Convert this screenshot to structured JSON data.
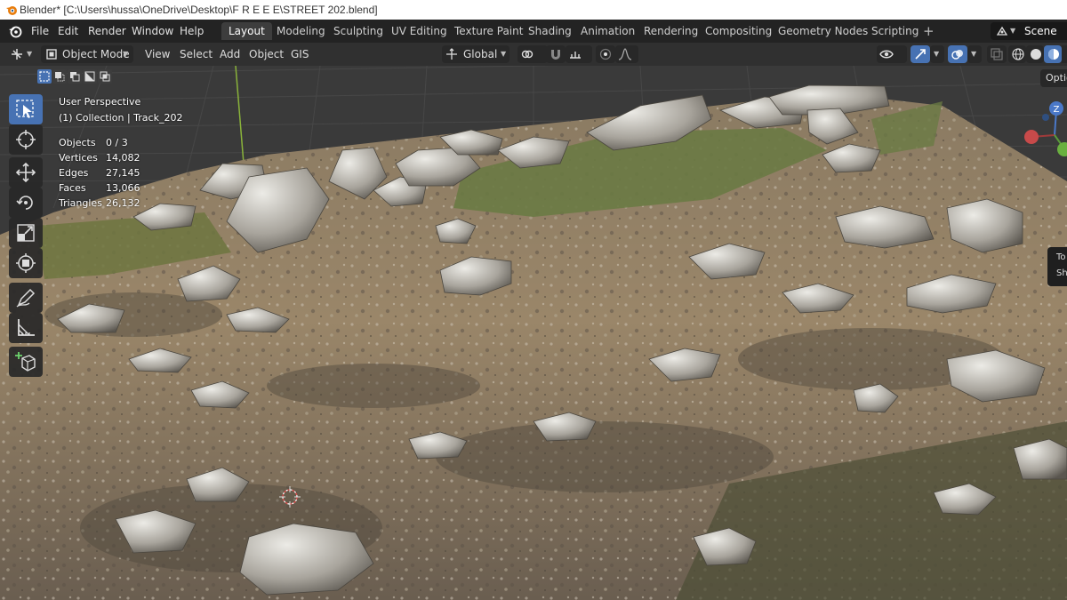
{
  "window": {
    "title": "Blender* [C:\\Users\\hussa\\OneDrive\\Desktop\\F R E E E\\STREET 202.blend]"
  },
  "menus": [
    "File",
    "Edit",
    "Render",
    "Window",
    "Help"
  ],
  "workspaces": [
    {
      "label": "Layout",
      "active": true
    },
    {
      "label": "Modeling"
    },
    {
      "label": "Sculpting"
    },
    {
      "label": "UV Editing"
    },
    {
      "label": "Texture Paint"
    },
    {
      "label": "Shading"
    },
    {
      "label": "Animation"
    },
    {
      "label": "Rendering"
    },
    {
      "label": "Compositing"
    },
    {
      "label": "Geometry Nodes"
    },
    {
      "label": "Scripting"
    }
  ],
  "add_workspace": "+",
  "scene": {
    "label": "Scene"
  },
  "viewport_header": {
    "mode": "Object Mode",
    "menus": [
      "View",
      "Select",
      "Add",
      "Object",
      "GIS"
    ],
    "transform_orientation": "Global"
  },
  "overlay": {
    "perspective": "User Perspective",
    "collection": "(1) Collection | Track_202",
    "stats": [
      {
        "label": "Objects",
        "value": "0 / 3"
      },
      {
        "label": "Vertices",
        "value": "14,082"
      },
      {
        "label": "Edges",
        "value": "27,145"
      },
      {
        "label": "Faces",
        "value": "13,066"
      },
      {
        "label": "Triangles",
        "value": "26,132"
      }
    ]
  },
  "tools": [
    {
      "name": "tweak-tool",
      "icon": "select-cursor-icon",
      "active": true
    },
    {
      "name": "cursor-tool",
      "icon": "3d-cursor-icon"
    },
    {
      "name": "move-tool",
      "icon": "move-arrows-icon"
    },
    {
      "name": "rotate-tool",
      "icon": "rotate-icon"
    },
    {
      "name": "scale-tool",
      "icon": "scale-icon"
    },
    {
      "name": "transform-tool",
      "icon": "transform-icon"
    },
    {
      "name": "annotate-tool",
      "icon": "pencil-icon"
    },
    {
      "name": "measure-tool",
      "icon": "ruler-icon"
    },
    {
      "name": "add-cube-tool",
      "icon": "add-cube-icon"
    }
  ],
  "options_label": "Options",
  "sidebar_tab": {
    "line1": "To",
    "line2": "Sh"
  },
  "gizmo": {
    "z_label": "Z"
  },
  "colors": {
    "accent": "#4772b3",
    "header": "#303030",
    "topbar": "#232323"
  }
}
